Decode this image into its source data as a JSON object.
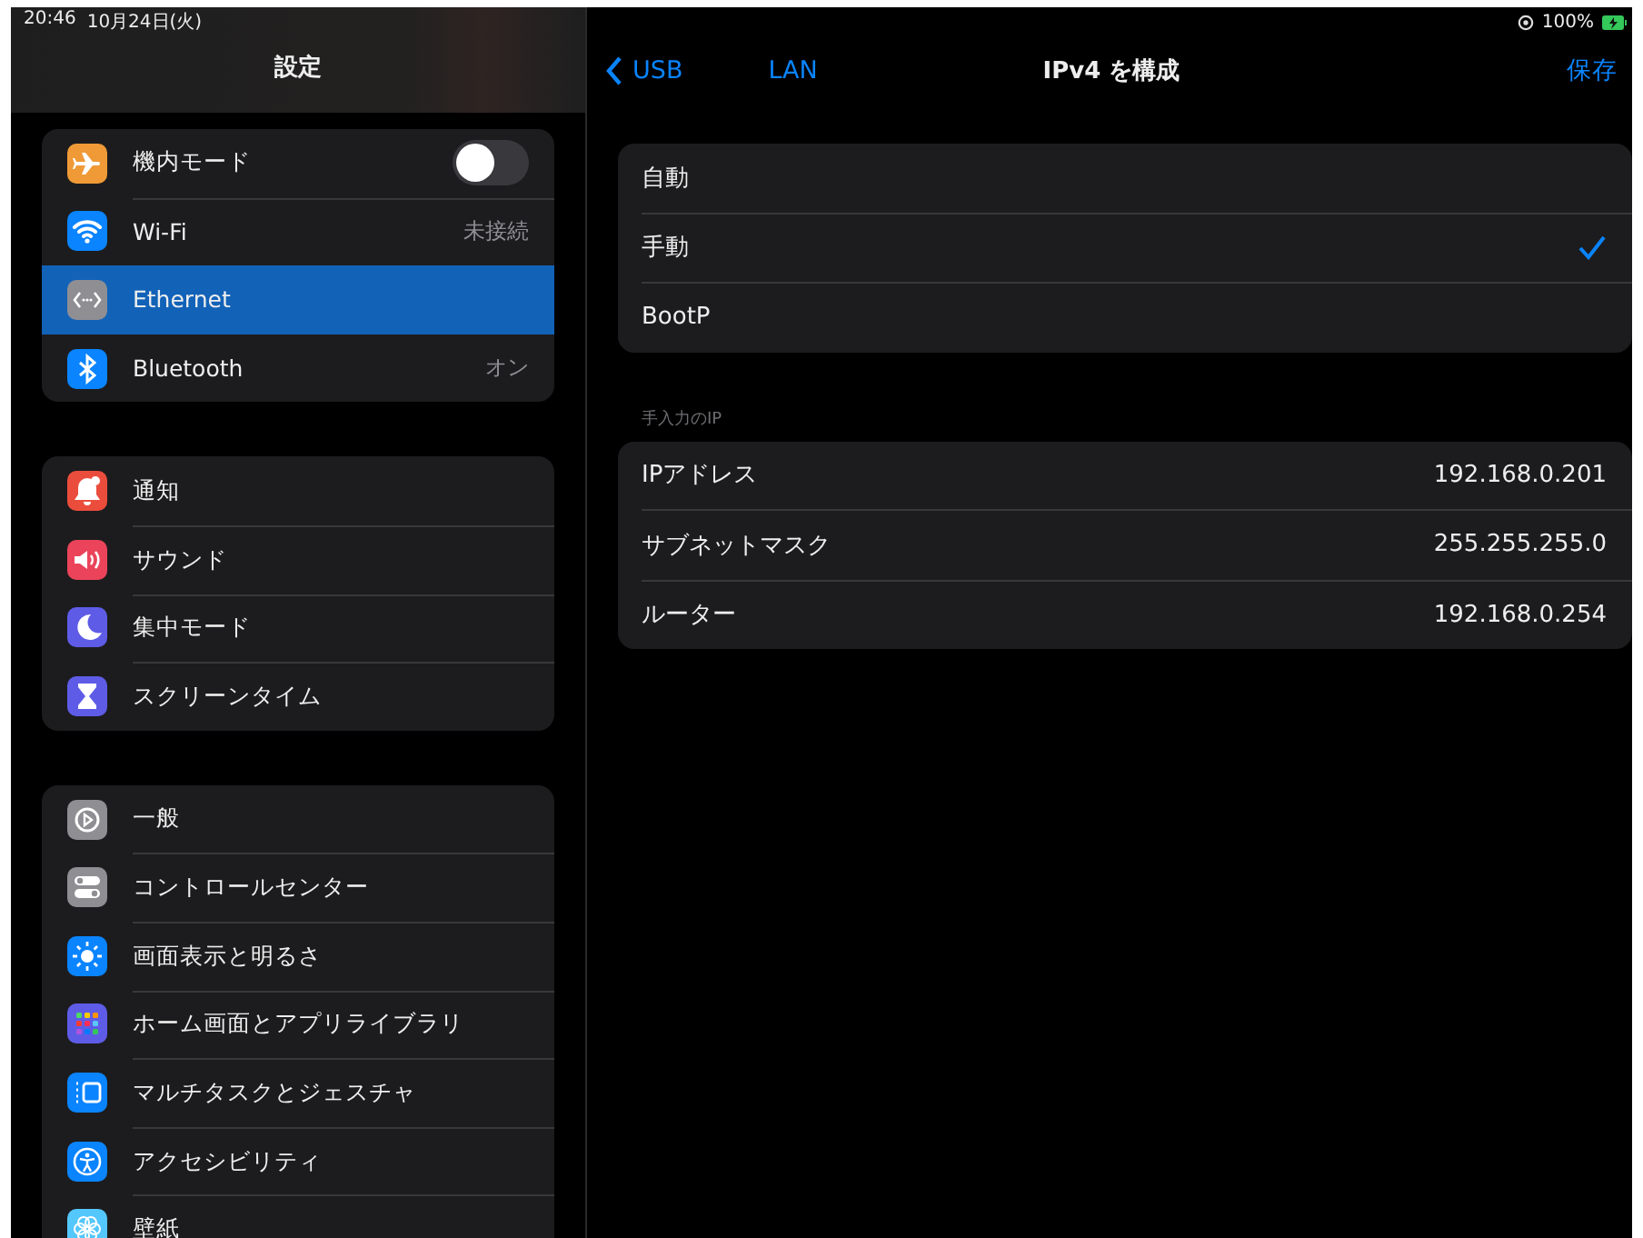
{
  "status_bar": {
    "time": "20:46",
    "date": "10月24日(火)",
    "battery": "100%"
  },
  "sidebar": {
    "title": "設定",
    "groups": [
      {
        "items": [
          {
            "label": "機内モード",
            "kind": "toggle",
            "on": false,
            "selected": false,
            "color": "#f09a37"
          },
          {
            "label": "Wi-Fi",
            "kind": "value",
            "value": "未接続",
            "selected": false,
            "color": "#0a84ff"
          },
          {
            "label": "Ethernet",
            "kind": "plain",
            "selected": true,
            "color": "#8e8e93"
          },
          {
            "label": "Bluetooth",
            "kind": "value",
            "value": "オン",
            "selected": false,
            "color": "#0a84ff"
          }
        ]
      },
      {
        "items": [
          {
            "label": "通知",
            "kind": "plain",
            "selected": false,
            "color": "#eb4d3d"
          },
          {
            "label": "サウンド",
            "kind": "plain",
            "selected": false,
            "color": "#eb445a"
          },
          {
            "label": "集中モード",
            "kind": "plain",
            "selected": false,
            "color": "#5e5ce6"
          },
          {
            "label": "スクリーンタイム",
            "kind": "plain",
            "selected": false,
            "color": "#5e5ce6"
          }
        ]
      },
      {
        "items": [
          {
            "label": "一般",
            "kind": "plain",
            "selected": false,
            "color": "#8e8e93"
          },
          {
            "label": "コントロールセンター",
            "kind": "plain",
            "selected": false,
            "color": "#8e8e93"
          },
          {
            "label": "画面表示と明るさ",
            "kind": "plain",
            "selected": false,
            "color": "#0a84ff"
          },
          {
            "label": "ホーム画面とアプリライブラリ",
            "kind": "plain",
            "selected": false,
            "color": "#5e5ce6"
          },
          {
            "label": "マルチタスクとジェスチャ",
            "kind": "plain",
            "selected": false,
            "color": "#0a84ff"
          },
          {
            "label": "アクセシビリティ",
            "kind": "plain",
            "selected": false,
            "color": "#0a84ff"
          },
          {
            "label": "壁紙",
            "kind": "plain",
            "selected": false,
            "color": "#54c7fc"
          }
        ]
      }
    ]
  },
  "nav": {
    "back": "USB",
    "crumb": "LAN",
    "title": "IPv4 を構成",
    "action": "保存"
  },
  "methods": [
    {
      "label": "自動",
      "selected": false
    },
    {
      "label": "手動",
      "selected": true
    },
    {
      "label": "BootP",
      "selected": false
    }
  ],
  "manual": {
    "header": "手入力のIP",
    "fields": [
      {
        "label": "IPアドレス",
        "value": "192.168.0.201"
      },
      {
        "label": "サブネットマスク",
        "value": "255.255.255.0"
      },
      {
        "label": "ルーター",
        "value": "192.168.0.254"
      }
    ]
  }
}
